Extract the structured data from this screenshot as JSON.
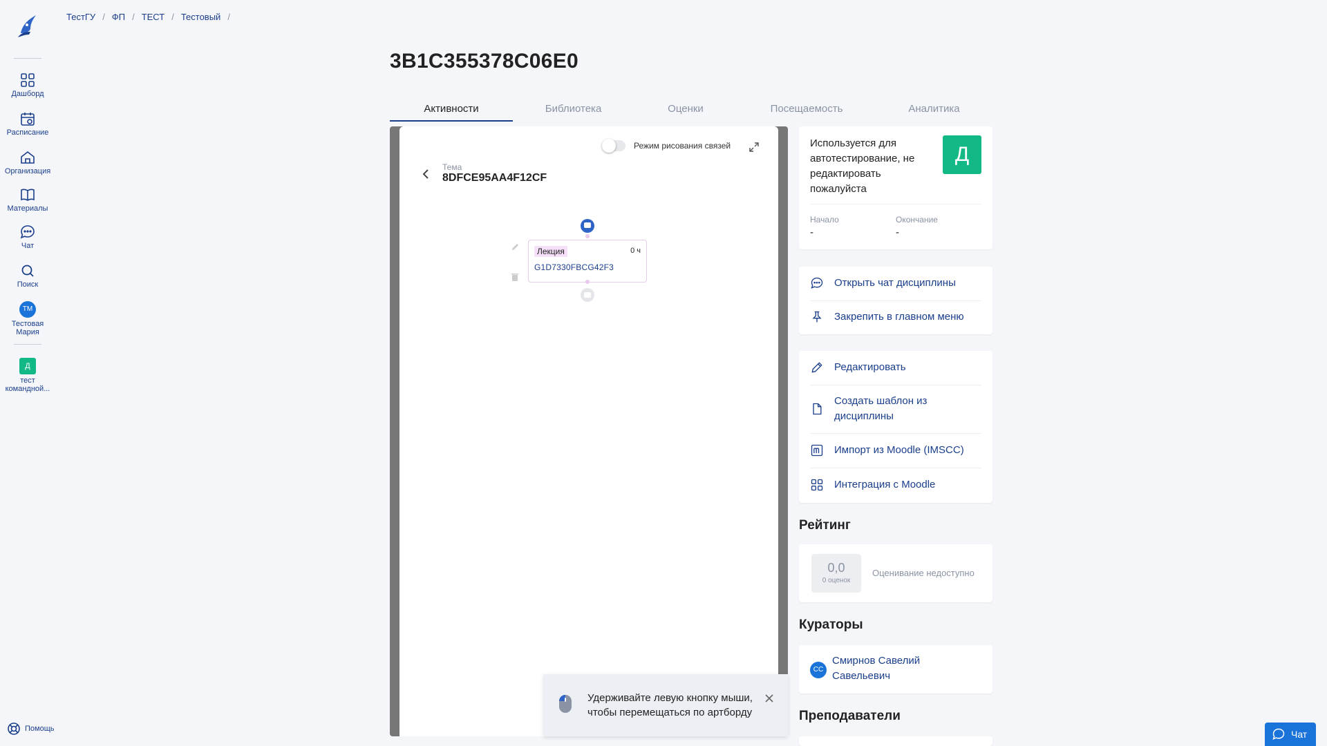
{
  "sidebar": {
    "items": [
      {
        "label": "Дашборд",
        "icon": "dashboard-icon"
      },
      {
        "label": "Расписание",
        "icon": "schedule-icon"
      },
      {
        "label": "Организация",
        "icon": "organization-icon"
      },
      {
        "label": "Материалы",
        "icon": "materials-icon"
      },
      {
        "label": "Чат",
        "icon": "chat-icon"
      },
      {
        "label": "Поиск",
        "icon": "search-icon"
      }
    ],
    "user": {
      "initials": "ТМ",
      "name": "Тестовая Мария"
    },
    "team": {
      "badge": "Д",
      "name": "тест командной..."
    },
    "help": "Помощь"
  },
  "breadcrumb": [
    "ТестГУ",
    "ФП",
    "ТЕСТ",
    "Тестовый"
  ],
  "title": "3B1C355378C06E0",
  "tabs": [
    "Активности",
    "Библиотека",
    "Оценки",
    "Посещаемость",
    "Аналитика"
  ],
  "active_tab": 0,
  "board": {
    "toggle_label": "Режим рисования связей",
    "toggle_on": false,
    "theme_label": "Тема",
    "theme_name": "8DFCE95AA4F12CF",
    "card": {
      "type": "Лекция",
      "hours": "0 ч",
      "code": "G1D7330FBCG42F3"
    },
    "hint": "Удерживайте левую кнопку мыши, чтобы перемещаться по артборду"
  },
  "info": {
    "description": "Используется для автотестирование, не редактировать пожалуйста",
    "badge": "Д",
    "start_label": "Начало",
    "start_value": "-",
    "end_label": "Окончание",
    "end_value": "-"
  },
  "actions_group1": [
    "Открыть чат дисциплины",
    "Закрепить в главном меню"
  ],
  "actions_group2": [
    "Редактировать",
    "Создать шаблон из дисциплины",
    "Импорт из Moodle (IMSCC)",
    "Интеграция с Moodle"
  ],
  "rating": {
    "heading": "Рейтинг",
    "value": "0,0",
    "count": "0 оценок",
    "status": "Оценивание недоступно"
  },
  "curators": {
    "heading": "Кураторы",
    "initials": "СС",
    "name": "Смирнов Савелий Савельевич"
  },
  "teachers": {
    "heading": "Преподаватели"
  },
  "chat_fab": "Чат",
  "colors": {
    "accent": "#1a3e8c",
    "brand_green": "#12b886",
    "blue": "#1a73d9"
  }
}
